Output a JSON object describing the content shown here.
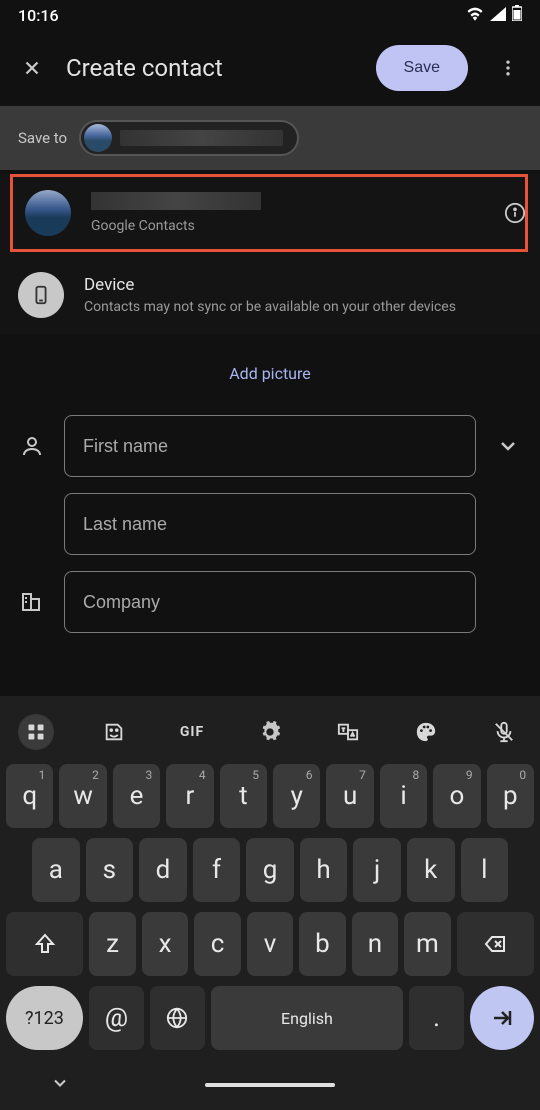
{
  "status": {
    "time": "10:16"
  },
  "header": {
    "title": "Create contact",
    "save_label": "Save"
  },
  "save_to": {
    "label": "Save to"
  },
  "options": {
    "google": {
      "subtitle": "Google Contacts"
    },
    "device": {
      "title": "Device",
      "subtitle": "Contacts may not sync or be available on your other devices"
    }
  },
  "add_picture": "Add picture",
  "fields": {
    "first_name_ph": "First name",
    "last_name_ph": "Last name",
    "company_ph": "Company"
  },
  "keyboard": {
    "row1": [
      {
        "k": "q",
        "s": "1"
      },
      {
        "k": "w",
        "s": "2"
      },
      {
        "k": "e",
        "s": "3"
      },
      {
        "k": "r",
        "s": "4"
      },
      {
        "k": "t",
        "s": "5"
      },
      {
        "k": "y",
        "s": "6"
      },
      {
        "k": "u",
        "s": "7"
      },
      {
        "k": "i",
        "s": "8"
      },
      {
        "k": "o",
        "s": "9"
      },
      {
        "k": "p",
        "s": "0"
      }
    ],
    "row2": [
      "a",
      "s",
      "d",
      "f",
      "g",
      "h",
      "j",
      "k",
      "l"
    ],
    "row3": [
      "z",
      "x",
      "c",
      "v",
      "b",
      "n",
      "m"
    ],
    "symbols": "?123",
    "at": "@",
    "space": "English",
    "period": "."
  }
}
